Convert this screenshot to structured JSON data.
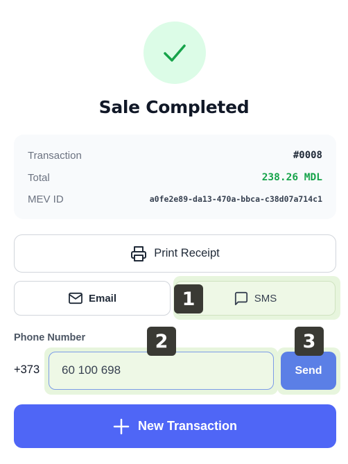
{
  "header": {
    "title": "Sale Completed",
    "status_icon": "check-icon"
  },
  "summary": {
    "rows": [
      {
        "label": "Transaction",
        "value": "#0008"
      },
      {
        "label": "Total",
        "value": "238.26 MDL"
      },
      {
        "label": "MEV ID",
        "value": "a0fe2e89-da13-470a-bbca-c38d07a714c1"
      }
    ]
  },
  "actions": {
    "print_label": "Print Receipt",
    "email_label": "Email",
    "sms_label": "SMS"
  },
  "phone": {
    "label": "Phone Number",
    "prefix": "+373",
    "value": "60 100 698",
    "send_label": "Send"
  },
  "new_transaction_label": "New Transaction",
  "badges": [
    "1",
    "2",
    "3"
  ],
  "colors": {
    "accent": "#4f66f6",
    "success": "#16a34a",
    "highlight": "#e7f5dd"
  }
}
